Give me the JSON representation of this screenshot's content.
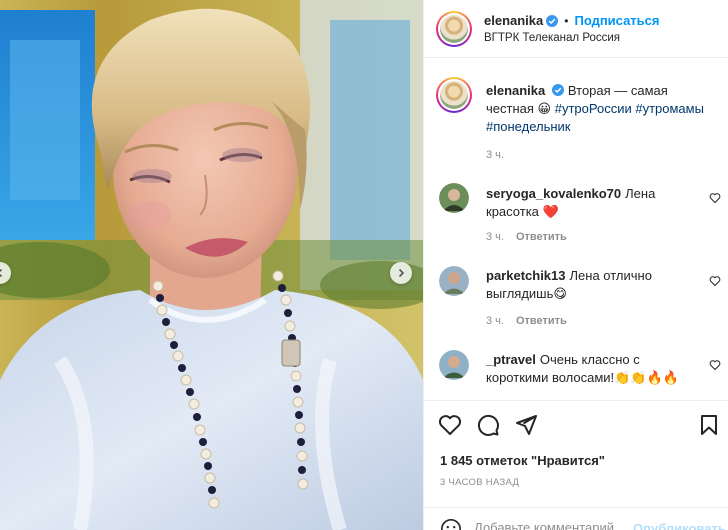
{
  "post": {
    "author": "elenanika",
    "follow_label": "Подписаться",
    "separator": "•",
    "location": "ВГТРК Телеканал Россия"
  },
  "caption": {
    "username": "elenanika",
    "text": "Вторая — самая честная",
    "emoji": "😀",
    "hashtags": [
      "#утроРоссии",
      "#утромамы",
      "#понедельник"
    ],
    "time": "3 ч."
  },
  "comments": [
    {
      "username": "seryoga_kovalenko70",
      "text": "Лена красотка",
      "emoji": "❤️",
      "time": "3 ч.",
      "reply_label": "Ответить"
    },
    {
      "username": "parketchik13",
      "text": "Лена отлично выглядишь",
      "emoji": "😋",
      "time": "3 ч.",
      "reply_label": "Ответить"
    },
    {
      "username": "_ptravel",
      "text": "Очень классно с короткими волосами!",
      "emoji": "👏👏🔥🔥",
      "time": "",
      "reply_label": ""
    }
  ],
  "likes_text": "1 845 отметок \"Нравится\"",
  "timestamp": "3 ЧАСОВ НАЗАД",
  "add_comment": {
    "placeholder": "Добавьте комментарий...",
    "publish_label": "Опубликовать"
  },
  "colors": {
    "accent_blue": "#0095f6",
    "hashtag": "#00376b",
    "muted": "#8e8e8e",
    "heart_red": "#ed4956"
  }
}
